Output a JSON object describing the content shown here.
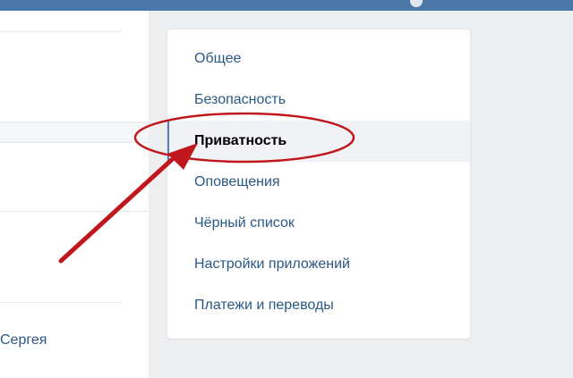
{
  "colors": {
    "accent": "#4a76a8",
    "link": "#2a5885",
    "active_text": "#000000",
    "annotation": "#c0171d"
  },
  "left_panel": {
    "partial_name": "Сергея"
  },
  "settings_menu": {
    "items": [
      {
        "label": "Общее",
        "active": false
      },
      {
        "label": "Безопасность",
        "active": false
      },
      {
        "label": "Приватность",
        "active": true
      },
      {
        "label": "Оповещения",
        "active": false
      },
      {
        "label": "Чёрный список",
        "active": false
      },
      {
        "label": "Настройки приложений",
        "active": false
      },
      {
        "label": "Платежи и переводы",
        "active": false
      }
    ]
  },
  "annotation": {
    "icon": "arrow-icon",
    "highlight": "ellipse"
  }
}
